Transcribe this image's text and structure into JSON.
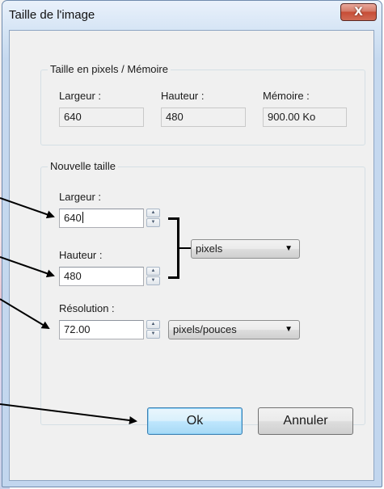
{
  "window": {
    "title": "Taille de l'image",
    "close_glyph": "X"
  },
  "current_size": {
    "group_label": "Taille en pixels / Mémoire",
    "width_label": "Largeur :",
    "width_value": "640",
    "height_label": "Hauteur :",
    "height_value": "480",
    "memory_label": "Mémoire :",
    "memory_value": "900.00 Ko"
  },
  "new_size": {
    "group_label": "Nouvelle taille",
    "width_label": "Largeur :",
    "width_value": "640",
    "height_label": "Hauteur :",
    "height_value": "480",
    "unit_selected": "pixels",
    "resolution_label": "Résolution :",
    "resolution_value": "72.00",
    "resolution_unit_selected": "pixels/pouces"
  },
  "buttons": {
    "ok_label": "Ok",
    "cancel_label": "Annuler"
  },
  "icons": {
    "spin_up": "up-arrow-icon",
    "spin_down": "down-arrow-icon",
    "dropdown": "chevron-down-icon",
    "close": "close-icon"
  },
  "colors": {
    "close_button": "#c74d36",
    "ok_button_border": "#3c7fb1",
    "window_frame": "#c2d6ee",
    "client_bg": "#f0f0f0"
  }
}
